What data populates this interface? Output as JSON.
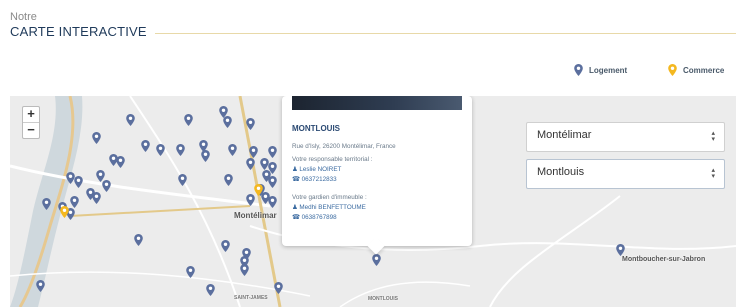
{
  "header": {
    "small": "Notre",
    "title": "CARTE INTERACTIVE"
  },
  "legend": [
    {
      "label": "Logement",
      "color": "#5b6f9e",
      "icon": "map-pin-icon"
    },
    {
      "label": "Commerce",
      "color": "#f4b820",
      "icon": "map-pin-icon"
    }
  ],
  "zoom": {
    "in": "+",
    "out": "−"
  },
  "map": {
    "labels": {
      "montelimar": "Montélimar",
      "montboucher": "Montboucher-sur-Jabron",
      "saint_james": "SAINT-JAMES",
      "montlouis": "MONTLOUIS"
    }
  },
  "popup": {
    "title": "MONTLOUIS",
    "address": "Rue d'Isly, 26200 Montélimar, France",
    "responsable_label": "Votre responsable territorial :",
    "responsable_name": "Leslie NOIRET",
    "responsable_phone": "0637212833",
    "gardien_label": "Votre gardien d'immeuble :",
    "gardien_name": "Medhi BENFETTOUME",
    "gardien_phone": "0638767898"
  },
  "selects": {
    "city": "Montélimar",
    "district": "Montlouis"
  }
}
